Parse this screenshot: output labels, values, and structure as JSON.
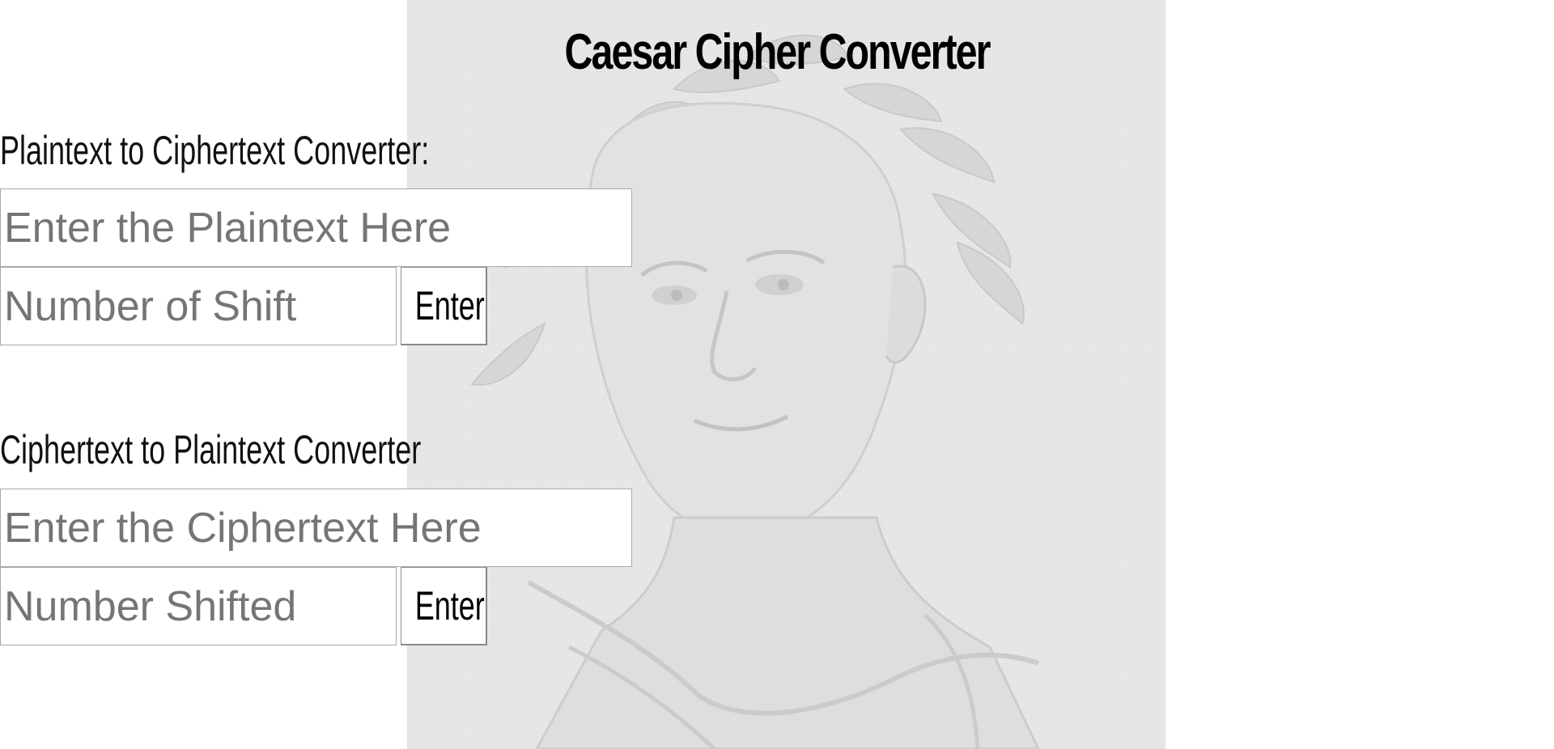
{
  "page": {
    "title": "Caesar Cipher Converter"
  },
  "encrypt": {
    "label": "Plaintext to Ciphertext Converter:",
    "text_placeholder": "Enter the Plaintext Here",
    "shift_placeholder": "Number of Shift",
    "button_label": "Enter"
  },
  "decrypt": {
    "label": "Ciphertext to Plaintext Converter",
    "text_placeholder": "Enter the Ciphertext Here",
    "shift_placeholder": "Number Shifted",
    "button_label": "Enter"
  },
  "background": {
    "image_subject": "caesar-portrait",
    "tone": "#e9e9e9"
  }
}
